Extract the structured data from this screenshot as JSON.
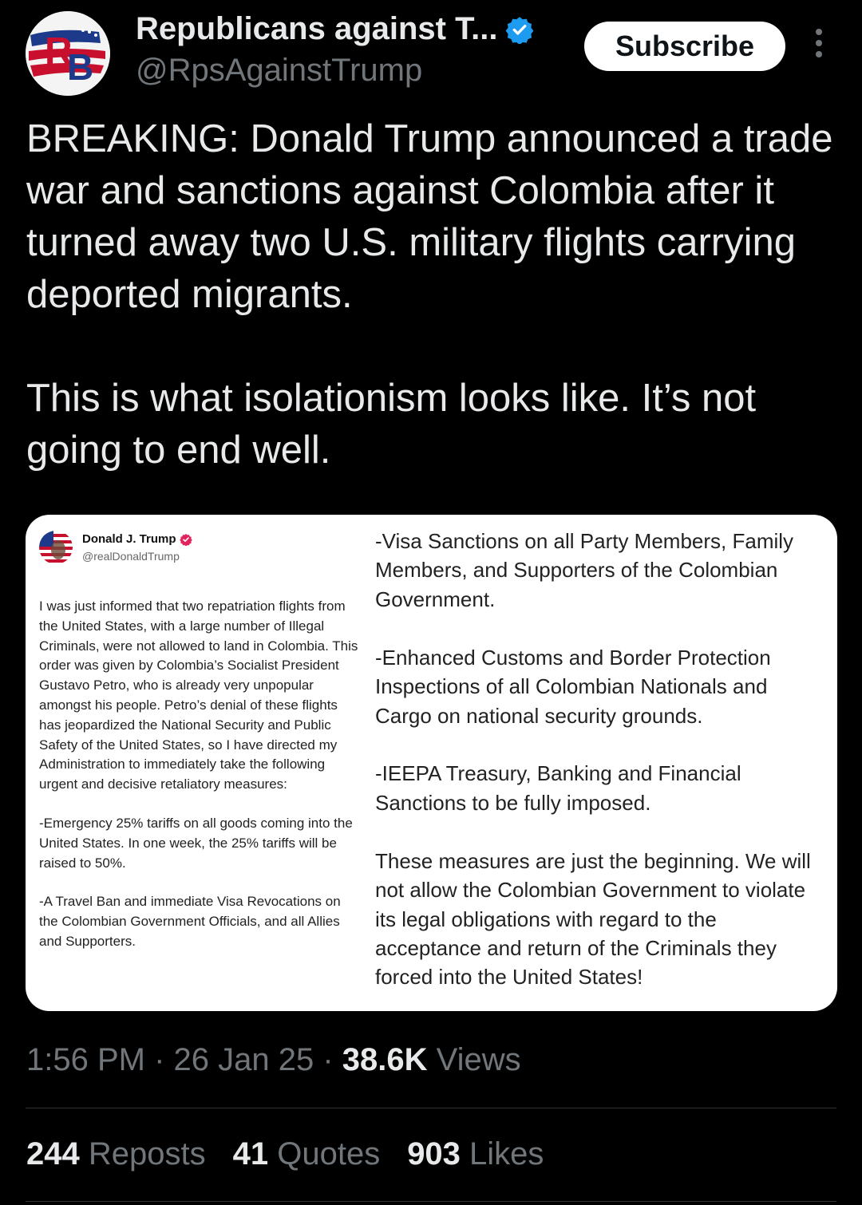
{
  "header": {
    "display_name": "Republicans against T...",
    "handle": "@RpsAgainstTrump",
    "subscribe_label": "Subscribe",
    "avatar_letters": "RB",
    "avatar_icon": "rb-logo-icon",
    "verified_icon": "verified-badge-icon",
    "more_icon": "more-vertical-icon"
  },
  "tweet": {
    "paragraphs": [
      "BREAKING: Donald Trump announced a trade war and sanctions against Colombia after it turned away two U.S. military flights carrying deported migrants.",
      "This is what isolationism looks like. It’s not going to end well."
    ]
  },
  "embedded_post": {
    "author_name": "Donald J. Trump",
    "author_handle": "@realDonaldTrump",
    "avatar_icon": "flag-portrait-icon",
    "left_paragraphs": [
      "I was just informed that two repatriation flights from the United States, with a large number of Illegal Criminals, were not allowed to land in Colombia. This order was given by Colombia’s Socialist President Gustavo Petro, who is already very unpopular amongst his people. Petro’s denial of these flights has jeopardized the National Security and Public Safety of the United States, so I have directed my Administration to immediately take the following urgent and decisive retaliatory measures:",
      "-Emergency 25% tariffs on all goods coming into the United States. In one week, the 25% tariffs will be raised to 50%.",
      "-A Travel Ban and immediate Visa Revocations on the Colombian Government Officials, and all Allies and Supporters."
    ],
    "right_paragraphs": [
      "-Visa Sanctions on all Party Members, Family Members, and Supporters of the Colombian Government.",
      "-Enhanced Customs and Border Protection Inspections of all Colombian Nationals and Cargo on national security grounds.",
      "-IEEPA Treasury, Banking and Financial Sanctions to be fully imposed.",
      "These measures are just the beginning. We will not allow the Colombian Government to violate its legal obligations with regard to the acceptance and return of the Criminals they forced into the United States!"
    ]
  },
  "meta": {
    "time": "1:56 PM",
    "sep": " · ",
    "date": "26 Jan 25",
    "views_count": "38.6K",
    "views_label": " Views"
  },
  "stats": {
    "reposts_count": "244",
    "reposts_label": " Reposts",
    "quotes_count": "41",
    "quotes_label": " Quotes",
    "likes_count": "903",
    "likes_label": " Likes"
  },
  "colors": {
    "background": "#000000",
    "primary_text": "#e7e9ea",
    "secondary_text": "#71767b",
    "verified_blue": "#1d9bf0",
    "verified_pink": "#e0245e",
    "brand_red": "#c8102e",
    "brand_blue": "#1d3a8a"
  }
}
